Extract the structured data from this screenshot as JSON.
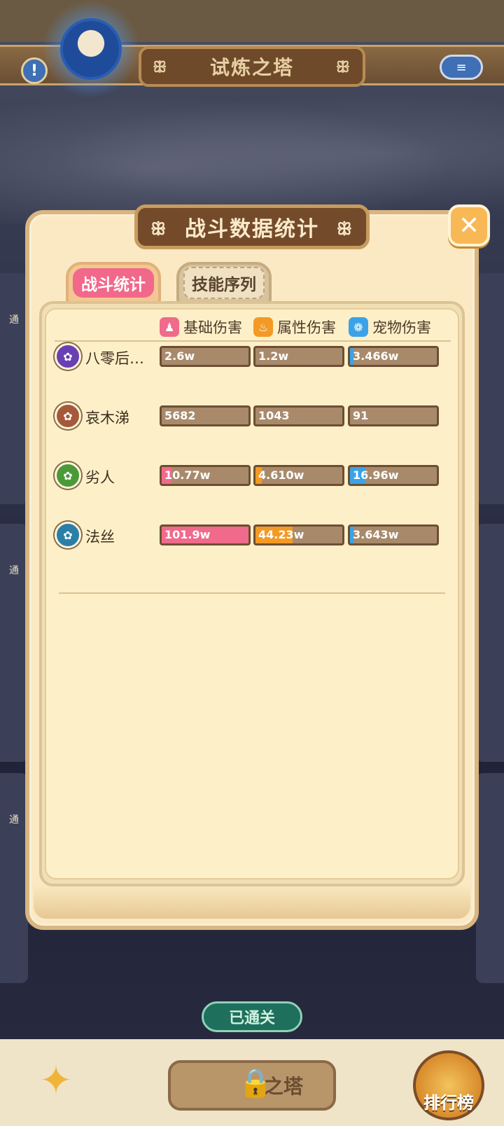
{
  "tower": {
    "title": "试炼之塔",
    "info_label": "!",
    "menu_label": "≡"
  },
  "side": {
    "left_label": "通",
    "left_label_2": "通",
    "left_label_3": "通"
  },
  "modal": {
    "title": "战斗数据统计",
    "close_label": "✕",
    "tabs": [
      {
        "label": "战斗统计",
        "active": true
      },
      {
        "label": "技能序列",
        "active": false
      }
    ],
    "columns": [
      {
        "label": "基础伤害",
        "icon": "person-icon",
        "color": "#f06a8b"
      },
      {
        "label": "属性伤害",
        "icon": "flame-icon",
        "color": "#f39a24"
      },
      {
        "label": "宠物伤害",
        "icon": "paw-icon",
        "color": "#3aa3e8"
      }
    ],
    "rows": [
      {
        "name": "八零后…",
        "icon_color": "#6a3fb3",
        "values": [
          {
            "text": "2.6w",
            "fill": 0.0
          },
          {
            "text": "1.2w",
            "fill": 0.0
          },
          {
            "text": "3.466w",
            "fill": 0.04
          }
        ]
      },
      {
        "name": "哀木涕",
        "icon_color": "#a45a3a",
        "values": [
          {
            "text": "5682",
            "fill": 0.0
          },
          {
            "text": "1043",
            "fill": 0.0
          },
          {
            "text": "91",
            "fill": 0.0
          }
        ]
      },
      {
        "name": "劣人",
        "icon_color": "#4a9a3a",
        "values": [
          {
            "text": "10.77w",
            "fill": 0.11
          },
          {
            "text": "4.610w",
            "fill": 0.07
          },
          {
            "text": "16.96w",
            "fill": 0.18
          }
        ]
      },
      {
        "name": "法丝",
        "icon_color": "#2a7fa8",
        "values": [
          {
            "text": "101.9w",
            "fill": 1.0
          },
          {
            "text": "44.23w",
            "fill": 0.43
          },
          {
            "text": "3.643w",
            "fill": 0.04
          }
        ]
      }
    ]
  },
  "bottom": {
    "cleared_label": "已通关",
    "lock_label": "之塔",
    "rank_label": "排行榜"
  }
}
